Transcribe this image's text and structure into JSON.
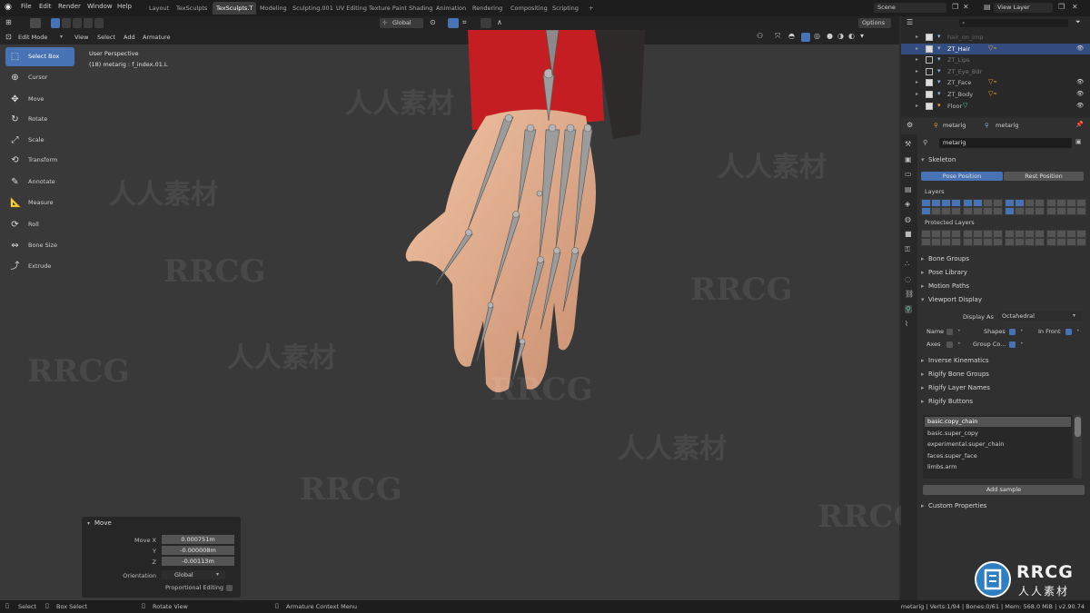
{
  "topbar": {
    "menus": [
      "File",
      "Edit",
      "Render",
      "Window",
      "Help"
    ],
    "workspaces": [
      "Layout",
      "TexSculpts",
      "TexSculpts.T",
      "Modeling",
      "Sculpting.001",
      "UV Editing",
      "Texture Paint",
      "Shading",
      "Animation",
      "Rendering",
      "Compositing",
      "Scripting"
    ],
    "active_workspace_index": 2,
    "add_label": "+",
    "scene": "Scene",
    "view_layer": "View Layer"
  },
  "viewport_header": {
    "mode": "Edit Mode",
    "menus": [
      "View",
      "Select",
      "Add",
      "Armature"
    ],
    "orientation": "Global",
    "options": "Options"
  },
  "viewport": {
    "perspective": "User Perspective",
    "object_info": "(18) metarig : f_index.01.L"
  },
  "toolbar": [
    {
      "label": "Select Box",
      "icon": "select-box-icon",
      "active": true
    },
    {
      "label": "Cursor",
      "icon": "cursor-icon",
      "active": false
    },
    {
      "label": "Move",
      "icon": "move-icon",
      "active": false
    },
    {
      "label": "Rotate",
      "icon": "rotate-icon",
      "active": false
    },
    {
      "label": "Scale",
      "icon": "scale-icon",
      "active": false
    },
    {
      "label": "Transform",
      "icon": "transform-icon",
      "active": false
    },
    {
      "label": "Annotate",
      "icon": "annotate-icon",
      "active": false
    },
    {
      "label": "Measure",
      "icon": "measure-icon",
      "active": false
    },
    {
      "label": "Roll",
      "icon": "roll-icon",
      "active": false
    },
    {
      "label": "Bone Size",
      "icon": "bone-size-icon",
      "active": false
    },
    {
      "label": "Extrude",
      "icon": "extrude-icon",
      "active": false
    }
  ],
  "move_panel": {
    "title": "Move",
    "fields": [
      {
        "label": "Move X",
        "value": "0.000751m"
      },
      {
        "label": "Y",
        "value": "-0.000008m"
      },
      {
        "label": "Z",
        "value": "-0.00113m"
      }
    ],
    "orientation_label": "Orientation",
    "orientation_value": "Global",
    "proportional_label": "Proportional Editing"
  },
  "outliner": {
    "rows": [
      {
        "name": "hair_on_imp",
        "selected": false
      },
      {
        "name": "ZT_Hair",
        "selected": true
      },
      {
        "name": "ZT_Lips",
        "selected": false
      },
      {
        "name": "ZT_Eye_Bdr",
        "selected": false
      },
      {
        "name": "ZT_Face",
        "selected": false
      },
      {
        "name": "ZT_Body",
        "selected": false
      },
      {
        "name": "Floor",
        "selected": false
      }
    ]
  },
  "properties": {
    "breadcrumb": [
      "metarig",
      "metarig"
    ],
    "object_name": "metarig",
    "skeleton": {
      "title": "Skeleton",
      "pose_position": "Pose Position",
      "rest_position": "Rest Position",
      "layers_label": "Layers",
      "protected_layers_label": "Protected Layers"
    },
    "sections_a": [
      "Bone Groups",
      "Pose Library",
      "Motion Paths"
    ],
    "viewport_display": {
      "title": "Viewport Display",
      "display_as_label": "Display As",
      "display_as_value": "Octahedral",
      "name_label": "Name",
      "shapes_label": "Shapes",
      "in_front_label": "In Front",
      "axes_label": "Axes",
      "group_colors_label": "Group Co..."
    },
    "sections_b": [
      "Inverse Kinematics",
      "Rigify Bone Groups",
      "Rigify Layer Names",
      "Rigify Buttons"
    ],
    "rigify_samples": [
      "basic.copy_chain",
      "basic.super_copy",
      "experimental.super_chain",
      "faces.super_face",
      "limbs.arm"
    ],
    "add_sample": "Add sample",
    "custom_properties": "Custom Properties"
  },
  "statusbar": {
    "select": "Select",
    "box_select": "Box Select",
    "rotate_view": "Rotate View",
    "context_menu": "Armature Context Menu",
    "stats": "metarig | Verts:1/94 | Bones:0/61 | Mem: 568.0 MiB | v2.90.74"
  },
  "watermarks": [
    "RRCG",
    "人人素材"
  ],
  "logo": {
    "name": "RRCG",
    "sub": "人人素材"
  },
  "colors": {
    "accent": "#4772b3",
    "sleeve": "#c41e22",
    "skin": "#e3b08f"
  }
}
